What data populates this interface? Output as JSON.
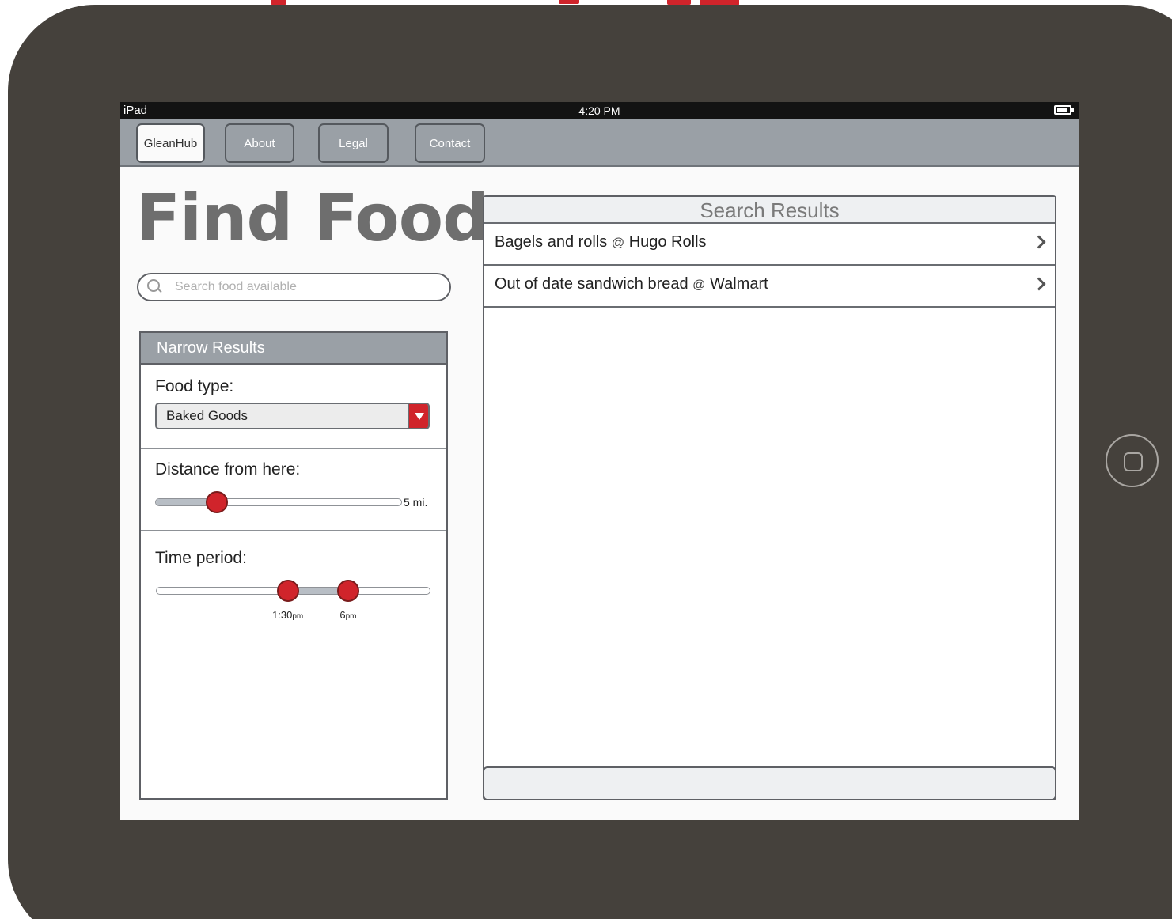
{
  "status_bar": {
    "device_name": "iPad",
    "time": "4:20 PM"
  },
  "nav": {
    "items": [
      {
        "label": "GleanHub",
        "active": true
      },
      {
        "label": "About",
        "active": false
      },
      {
        "label": "Legal",
        "active": false
      },
      {
        "label": "Contact",
        "active": false
      }
    ]
  },
  "page": {
    "title": "Find Food"
  },
  "search": {
    "placeholder": "Search food available",
    "value": ""
  },
  "filters": {
    "header": "Narrow Results",
    "food_type": {
      "label": "Food type:",
      "selected": "Baked Goods"
    },
    "distance": {
      "label": "Distance from here:",
      "max_label": "5 mi.",
      "value_fraction": 0.25
    },
    "time_period": {
      "label": "Time period:",
      "start_label": "1:30",
      "start_suffix": "pm",
      "end_label": "6",
      "end_suffix": "pm",
      "start_fraction": 0.48,
      "end_fraction": 0.7
    }
  },
  "results": {
    "header": "Search Results",
    "items": [
      {
        "item": "Bagels and rolls",
        "at": "@",
        "place": "Hugo Rolls"
      },
      {
        "item": "Out of date sandwich bread",
        "at": "@",
        "place": "Walmart"
      }
    ]
  },
  "colors": {
    "accent": "#d0242b",
    "frame": "#45413c",
    "nav_bar": "#9aa0a6",
    "status_bar": "#131313"
  }
}
